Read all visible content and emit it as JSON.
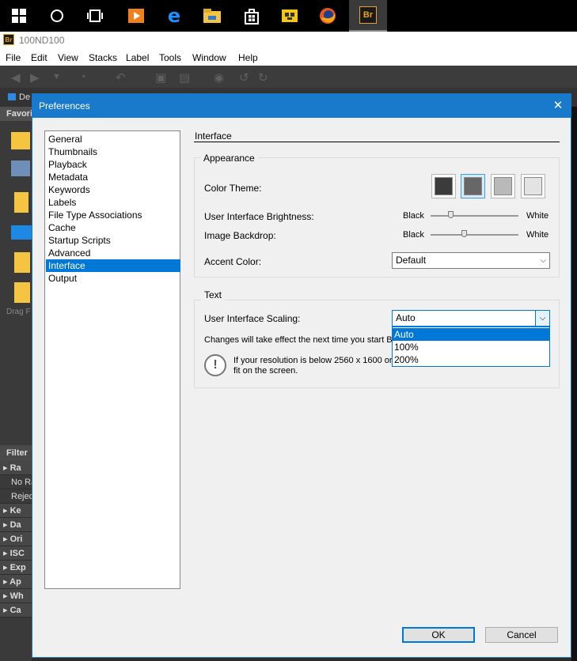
{
  "taskbar": {
    "icons": [
      "windows-start-icon",
      "cortana-search-icon",
      "task-view-icon",
      "media-player-icon",
      "edge-icon",
      "file-explorer-icon",
      "store-icon",
      "yellow-app-icon",
      "firefox-icon",
      "bridge-icon"
    ],
    "bridge_icon_text": "Br"
  },
  "app": {
    "icon_text": "Br",
    "window_title": "100ND100",
    "menu": [
      "File",
      "Edit",
      "View",
      "Stacks",
      "Label",
      "Tools",
      "Window",
      "Help"
    ],
    "path_fragment": "De",
    "favorites_fragment": "Favori",
    "drag_fragment": "Drag F",
    "filter_fragment": "Filter",
    "filter_rows": [
      "Ra",
      "No Ra",
      "Rejec",
      "Ke",
      "Da",
      "Ori",
      "ISC",
      "Exp",
      "Ap",
      "Wh",
      "Ca"
    ]
  },
  "dialog": {
    "title": "Preferences",
    "close_glyph": "✕",
    "categories": [
      "General",
      "Thumbnails",
      "Playback",
      "Metadata",
      "Keywords",
      "Labels",
      "File Type Associations",
      "Cache",
      "Startup Scripts",
      "Advanced",
      "Interface",
      "Output"
    ],
    "selected_category": "Interface",
    "section_title": "Interface",
    "appearance": {
      "group_label": "Appearance",
      "color_theme_label": "Color Theme:",
      "theme_colors": [
        "#3b3b3b",
        "#676767",
        "#b9b9b9",
        "#e3e3e3"
      ],
      "selected_theme_index": 1,
      "brightness_label": "User Interface Brightness:",
      "brightness_min": "Black",
      "brightness_max": "White",
      "brightness_value": 0.23,
      "backdrop_label": "Image Backdrop:",
      "backdrop_min": "Black",
      "backdrop_max": "White",
      "backdrop_value": 0.38,
      "accent_label": "Accent Color:",
      "accent_value": "Default"
    },
    "text": {
      "group_label": "Text",
      "scaling_label": "User Interface Scaling:",
      "scaling_value": "Auto",
      "scaling_options": [
        "Auto",
        "100%",
        "200%"
      ],
      "highlighted_option": "Auto",
      "restart_note": "Changes will take effect the next time you start B",
      "info_line1": "If your resolution is below 2560 x 1600 or",
      "info_line2": "fit on the screen.",
      "info_glyph": "!"
    },
    "ok_label": "OK",
    "cancel_label": "Cancel"
  },
  "colors": {
    "accent": "#0078d7",
    "dialog_titlebar": "#1979ca"
  }
}
